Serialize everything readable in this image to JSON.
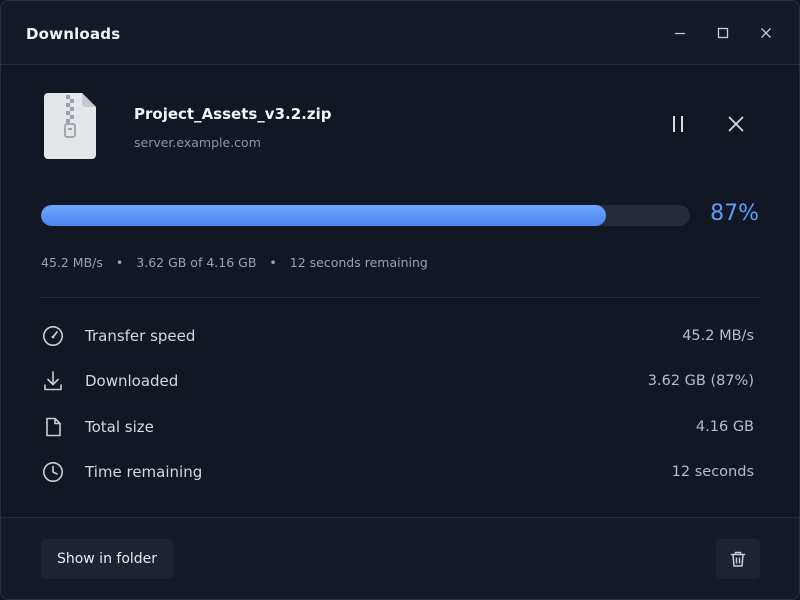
{
  "window": {
    "title": "Downloads"
  },
  "download": {
    "file_name": "Project_Assets_v3.2.zip",
    "source": "server.example.com",
    "progress_fraction": 0.87,
    "progress_label": "87%",
    "stats": {
      "speed": "45.2 MB/s",
      "amount": "3.62 GB of 4.16 GB",
      "remaining": "12 seconds remaining"
    }
  },
  "details": [
    {
      "icon": "speedometer-icon",
      "label": "Transfer speed",
      "value": "45.2 MB/s"
    },
    {
      "icon": "download-icon",
      "label": "Downloaded",
      "value": "3.62 GB (87%)"
    },
    {
      "icon": "file-icon",
      "label": "Total size",
      "value": "4.16 GB"
    },
    {
      "icon": "clock-icon",
      "label": "Time remaining",
      "value": "12 seconds"
    }
  ],
  "footer": {
    "show_in_folder_label": "Show in folder"
  },
  "colors": {
    "accent": "#5d9cff",
    "background": "#121724"
  }
}
